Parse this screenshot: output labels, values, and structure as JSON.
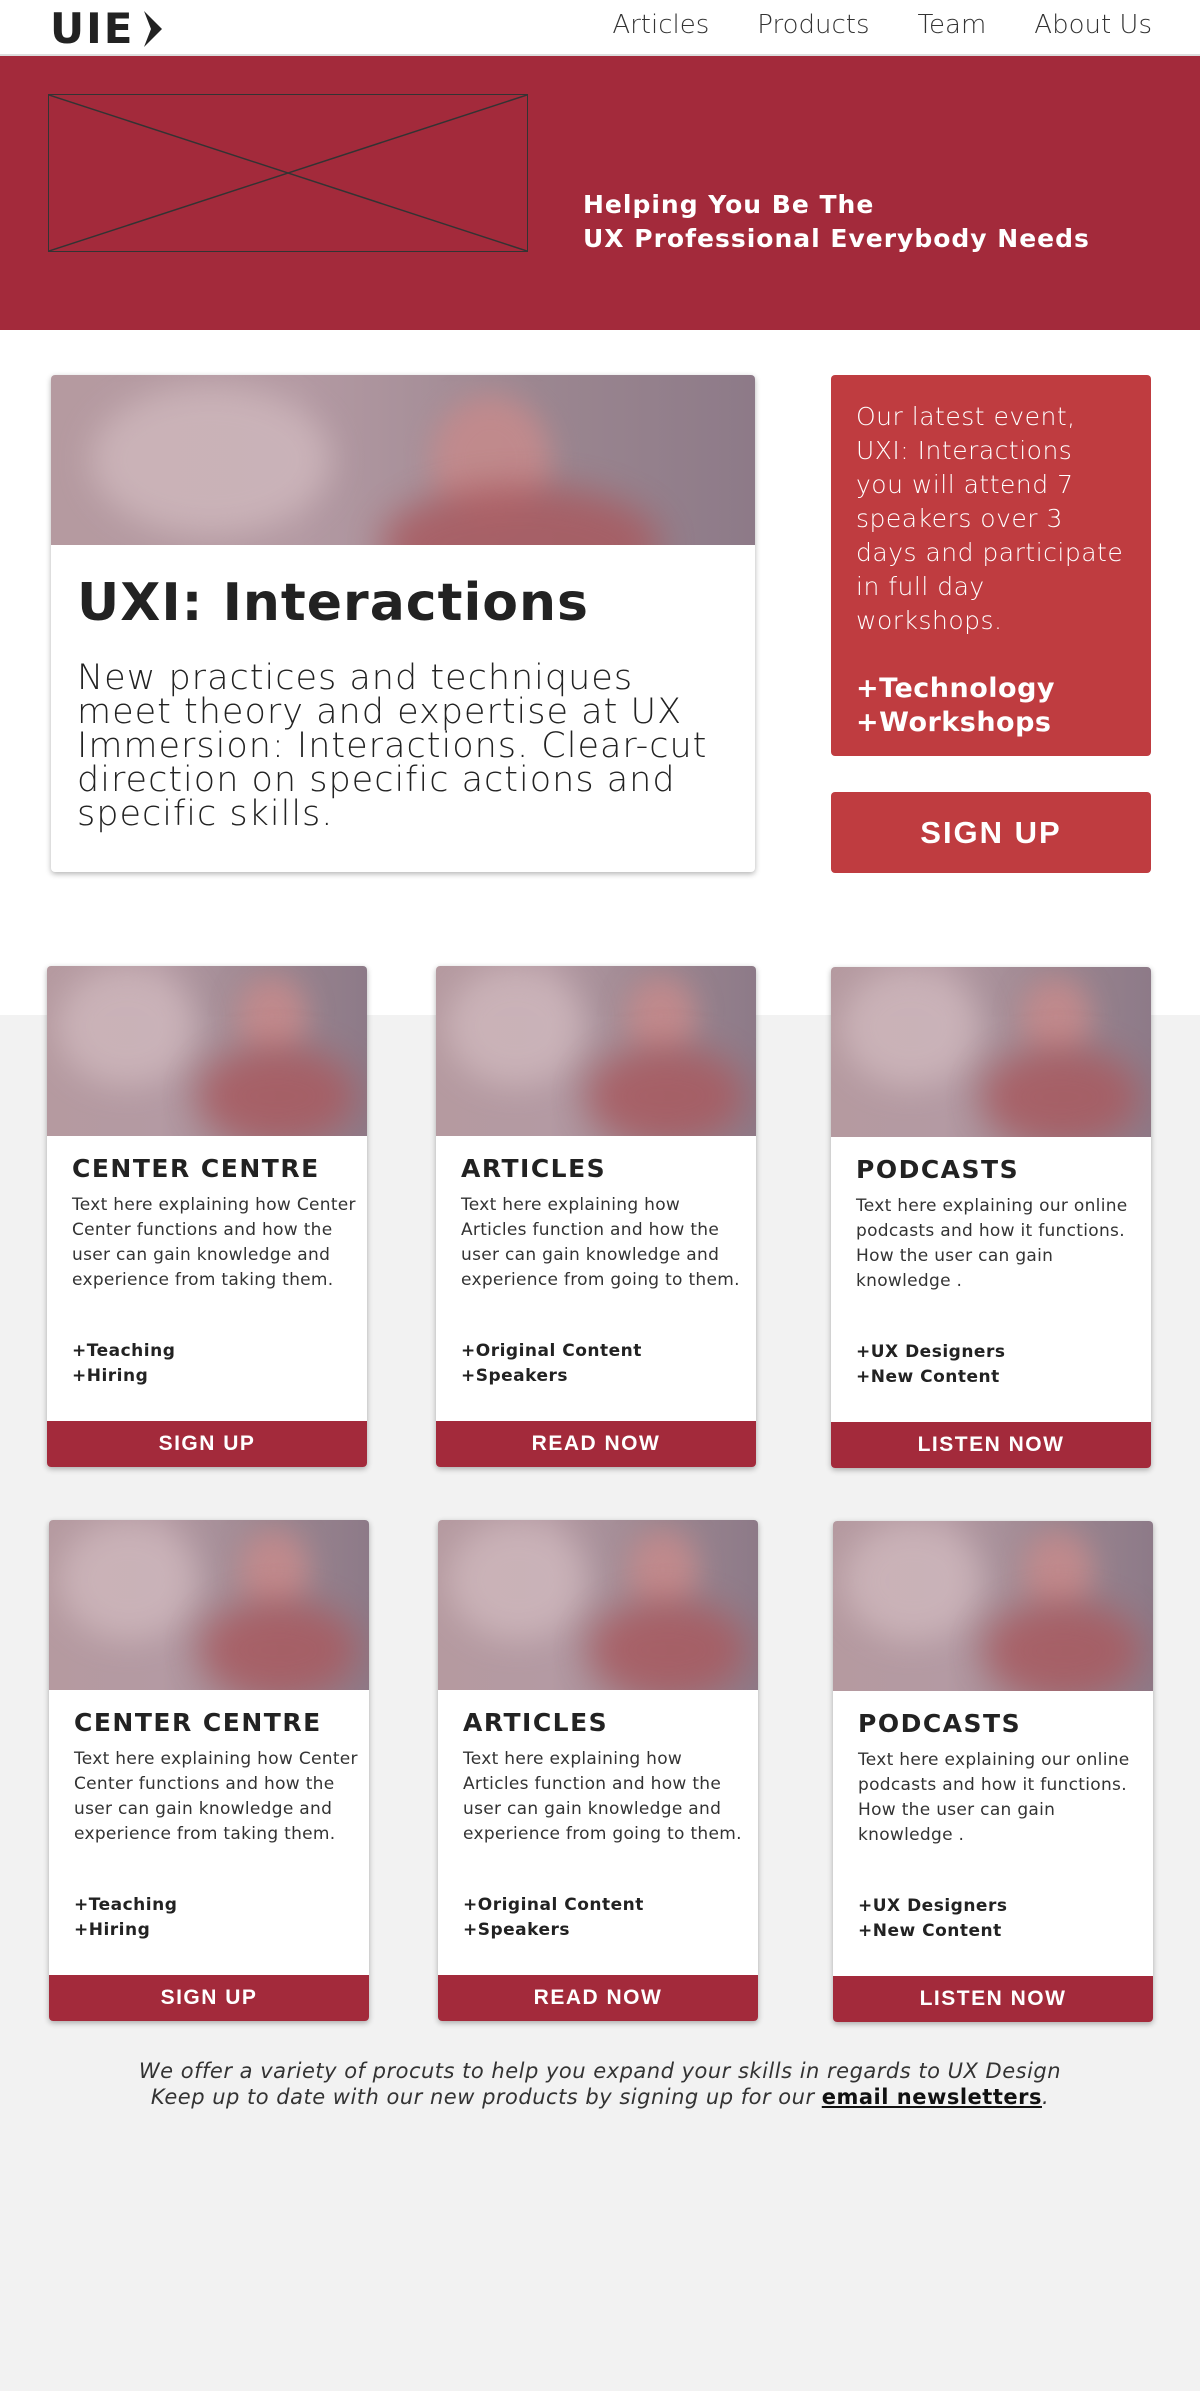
{
  "header": {
    "logo": "UIE",
    "nav": [
      "Articles",
      "Products",
      "Team",
      "About Us"
    ]
  },
  "hero": {
    "tagline_line1": "Helping You Be The",
    "tagline_line2": "UX Professional Everybody Needs"
  },
  "feature": {
    "title": "UXI: Interactions",
    "body": "New practices and techniques meet theory and expertise at UX Immersion: Interactions. Clear-cut direction on specific actions and specific skills."
  },
  "event": {
    "text": "Our latest event, UXI: Interactions you will attend 7 speakers over 3 days and participate in full day workshops.",
    "tag1": "+Technology",
    "tag2": "+Workshops",
    "signup_label": "SIGN UP"
  },
  "cards_row1": [
    {
      "title": "CENTER CENTRE",
      "desc": "Text here explaining how Center Center functions and how the user can gain knowledge and experience from taking them.",
      "tag1": "+Teaching",
      "tag2": "+Hiring",
      "button": "SIGN UP"
    },
    {
      "title": "ARTICLES",
      "desc": "Text here explaining how Articles function and how the user can gain knowledge and experience from going to them.",
      "tag1": "+Original Content",
      "tag2": "+Speakers",
      "button": "READ NOW"
    },
    {
      "title": "PODCASTS",
      "desc": "Text here explaining our online podcasts and how it functions. How the user can gain knowledge .",
      "tag1": "+UX Designers",
      "tag2": "+New Content",
      "button": "LISTEN NOW"
    }
  ],
  "cards_row2": [
    {
      "title": "CENTER CENTRE",
      "desc": "Text here explaining how Center Center functions and how the user can gain knowledge and experience from taking them.",
      "tag1": "+Teaching",
      "tag2": "+Hiring",
      "button": "SIGN UP"
    },
    {
      "title": "ARTICLES",
      "desc": "Text here explaining how Articles function and how the user can gain knowledge and experience from going to them.",
      "tag1": "+Original Content",
      "tag2": "+Speakers",
      "button": "READ NOW"
    },
    {
      "title": "PODCASTS",
      "desc": "Text here explaining our online podcasts and how it functions. How the user can gain knowledge .",
      "tag1": "+UX Designers",
      "tag2": "+New Content",
      "button": "LISTEN NOW"
    }
  ],
  "footer": {
    "line1": "We offer a variety of procuts to help you expand your skills in regards to UX Design",
    "line2_prefix": "Keep up to date with our new products by signing up for our",
    "link": "email newsletters",
    "line2_suffix": "."
  },
  "colors": {
    "brand": "#a32a3b",
    "event": "#bf3c40",
    "background": "#f2f2f2"
  }
}
